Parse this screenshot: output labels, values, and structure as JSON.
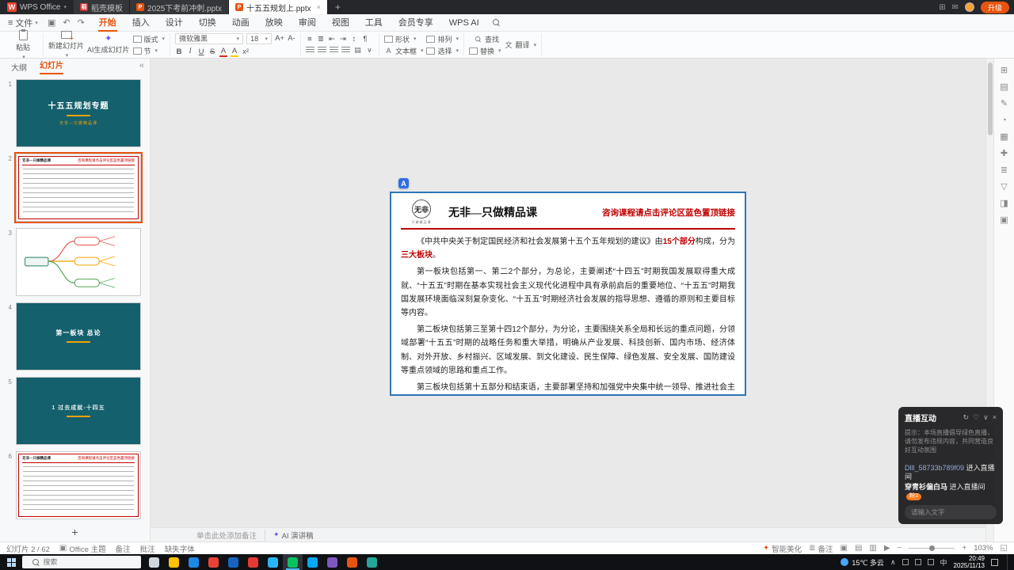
{
  "colors": {
    "accent": "#e8540f",
    "slide_teal": "#15606d",
    "highlight_red": "#c00000",
    "slide_border_blue": "#2e75b6",
    "live_badge_orange": "#ff7a1a"
  },
  "icons": {
    "menu": "≡",
    "save": "▣",
    "undo": "↶",
    "redo": "↷",
    "caret_down": "▾",
    "collapse": "«",
    "add_slide": "+",
    "ai_sparkle": "✦",
    "ai_letter": "A",
    "close": "×",
    "refresh": "↻",
    "heart": "♡",
    "chevron_down": "∨",
    "play": "▶",
    "view_normal": "▣",
    "view_sorter": "▤",
    "view_read": "▥",
    "zoom_out": "−",
    "zoom_in": "+",
    "fit": "◱",
    "beautify": "✦",
    "notes_toggle": "≣",
    "tray_up": "∧",
    "grid": "⊞",
    "mail": "✉",
    "translate": "文",
    "textbox_letter": "A"
  },
  "titlebar": {
    "app_name": "WPS Office",
    "logo_letter": "W",
    "tabs": [
      {
        "label": "稻壳模板",
        "icon_letter": "稻"
      },
      {
        "label": "2025下考前冲刺.pptx",
        "icon_letter": "P"
      },
      {
        "label": "十五五规划上.pptx",
        "icon_letter": "P"
      }
    ],
    "upgrade_label": "升级"
  },
  "menubar": {
    "file_label": "文件",
    "tabs": [
      "开始",
      "插入",
      "设计",
      "切换",
      "动画",
      "放映",
      "审阅",
      "视图",
      "工具",
      "会员专享",
      "WPS AI"
    ],
    "active_index": 0
  },
  "ribbon": {
    "paste": "粘贴",
    "new_slide": "新建幻灯片",
    "ai_slide": "AI生成幻灯片",
    "layout": "版式",
    "section": "节",
    "font_name": "微软雅黑",
    "font_size": "18",
    "font_buttons": [
      "B",
      "I",
      "U",
      "S",
      "A",
      "A",
      "x²"
    ],
    "font_size_buttons": [
      "A+",
      "A-"
    ],
    "para_icons": [
      "≡",
      "≣",
      "⇤",
      "⇥",
      "↕",
      "¶"
    ],
    "shape": "形状",
    "textbox": "文本框",
    "arrange": "排列",
    "select": "选择",
    "find": "查找",
    "replace": "替换",
    "translate": "翻译"
  },
  "left_panel": {
    "tab_outline": "大纲",
    "tab_slides": "幻灯片",
    "slides": [
      {
        "num": "1",
        "title": "十五五规划专题",
        "subtitle": "无非—只做精品课"
      },
      {
        "num": "2",
        "header": "无非—只做精品课",
        "note": "咨询课程请点击评论区蓝色置顶链接"
      },
      {
        "num": "3"
      },
      {
        "num": "4",
        "title": "第一板块 总论"
      },
      {
        "num": "5",
        "title": "1 过去成就-十四五"
      },
      {
        "num": "6",
        "header": "无非—只做精品课",
        "note": "咨询课程请点击评论区蓝色置顶链接"
      }
    ]
  },
  "slide": {
    "brand": "无非",
    "brand_sub": "只做精品课",
    "title": "无非—只做精品课",
    "notice": "咨询课程请点击评论区蓝色置顶链接",
    "p1_a": "《中共中央关于制定国民经济和社会发展第十五个五年规划的建议》由",
    "p1_b": "15个部分",
    "p1_c": "构成，分为",
    "p1_d": "三大板块",
    "p1_e": "。",
    "p2": "第一板块包括第一、第二2个部分，为总论，主要阐述“十四五”时期我国发展取得重大成就、“十五五”时期在基本实现社会主义现代化进程中具有承前启后的重要地位、“十五五”时期我国发展环境面临深刻复杂变化、“十五五”时期经济社会发展的指导思想、遵循的原则和主要目标等内容。",
    "p3": "第二板块包括第三至第十四12个部分，为分论，主要围绕关系全局和长远的重点问题，分领域部署“十五五”时期的战略任务和重大举措，明确从产业发展、科技创新、国内市场、经济体制、对外开放、乡村振兴、区域发展、到文化建设、民生保障、绿色发展、安全发展、国防建设等重点领域的思路和重点工作。",
    "p4": "第三板块包括第十五部分和结束语，主要部署坚持和加强党中央集中统一领导、推进社会主义民主法治建设、港澳台工作、推动构建人类命运共同体、充分调动全社会积极性主动性创造性等任务。"
  },
  "right_toolbar": [
    {
      "name": "properties-tool",
      "glyph": "⊞"
    },
    {
      "name": "design-tool",
      "glyph": "▤"
    },
    {
      "name": "edit-tool",
      "glyph": "✎"
    },
    {
      "name": "color-tool",
      "glyph": "◔"
    },
    {
      "name": "grid-tool",
      "glyph": "▦"
    },
    {
      "name": "insert-tool",
      "glyph": "✚"
    },
    {
      "name": "outline-tool",
      "glyph": "≣"
    },
    {
      "name": "more-tool",
      "glyph": "▽"
    },
    {
      "name": "split-tool",
      "glyph": "◨"
    },
    {
      "name": "panel-tool",
      "glyph": "▣"
    }
  ],
  "notes_bar": {
    "placeholder": "单击此处添加备注",
    "ai_label": "AI 演讲稿"
  },
  "statusbar": {
    "slide_indicator": "幻灯片 2 / 62",
    "theme": "Office 主题",
    "notes": "备注",
    "comments": "批注",
    "missing_fonts": "缺失字体",
    "beautify": "智能美化",
    "notes_toggle": "备注",
    "zoom": "103%"
  },
  "live_panel": {
    "title": "直播互动",
    "notice": "提示：本场直播倡导绿色直播，请勿发布违规内容，共同营造良好互动氛围",
    "messages": [
      {
        "user": "Dlll_58733b789f09",
        "action": "进入直播间",
        "badge": ""
      },
      {
        "user": "穿青衫偏白马",
        "action": "进入直播间",
        "badge": "粉3"
      }
    ],
    "input_placeholder": "请输入文字"
  },
  "taskbar": {
    "search_placeholder": "搜索",
    "apps": [
      {
        "name": "task-view",
        "color": "#cfd8dc"
      },
      {
        "name": "explorer",
        "color": "#ffc107"
      },
      {
        "name": "edge",
        "color": "#1e88e5"
      },
      {
        "name": "chrome",
        "color": "#ea4335"
      },
      {
        "name": "word",
        "color": "#1565c0"
      },
      {
        "name": "music",
        "color": "#e53935"
      },
      {
        "name": "dingtalk",
        "color": "#29b6f6"
      },
      {
        "name": "wechat",
        "color": "#07c160",
        "active": true
      },
      {
        "name": "qq",
        "color": "#03a9f4"
      },
      {
        "name": "cloud-drive",
        "color": "#7e57c2"
      },
      {
        "name": "wps",
        "color": "#e8540f"
      },
      {
        "name": "notepad",
        "color": "#26a69a"
      }
    ],
    "weather": "15℃ 多云",
    "input_method": "中",
    "time": "20:49",
    "date": "2025/11/13"
  }
}
